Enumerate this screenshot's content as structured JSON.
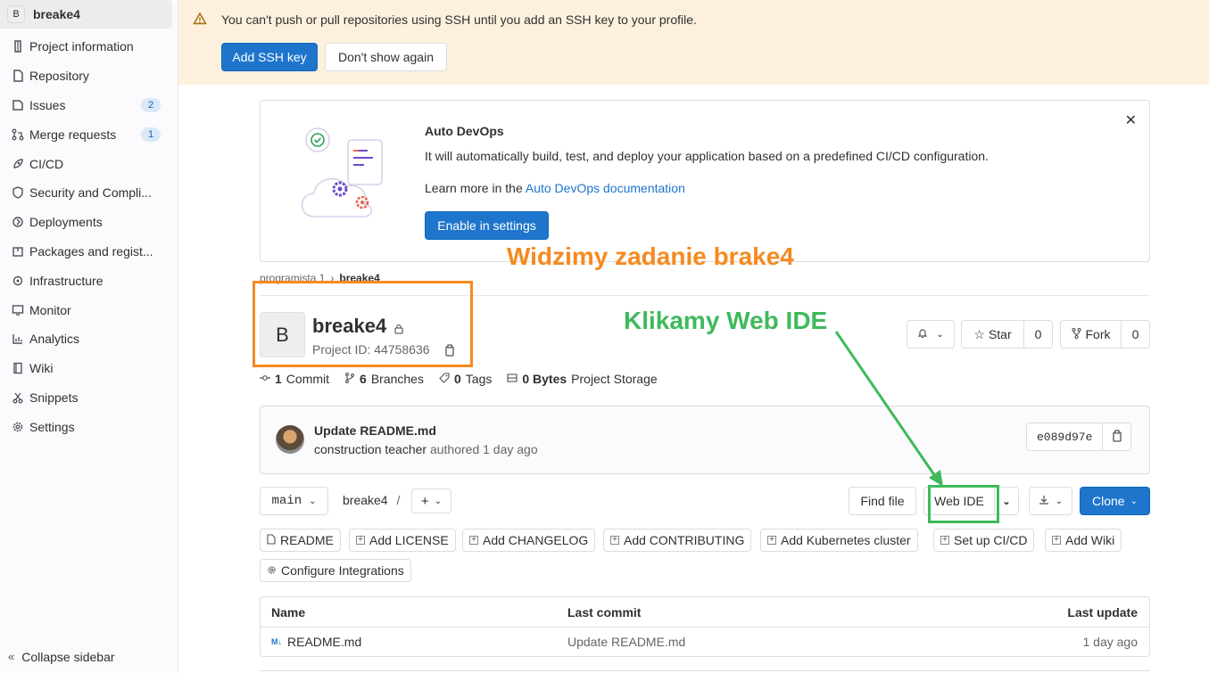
{
  "sidebar": {
    "project_avatar": "B",
    "project_name": "breake4",
    "items": [
      {
        "label": "Project information",
        "icon": "info-icon"
      },
      {
        "label": "Repository",
        "icon": "doc-icon"
      },
      {
        "label": "Issues",
        "icon": "issues-icon",
        "badge": "2"
      },
      {
        "label": "Merge requests",
        "icon": "merge-request-icon",
        "badge": "1"
      },
      {
        "label": "CI/CD",
        "icon": "rocket-icon"
      },
      {
        "label": "Security and Compli...",
        "icon": "shield-icon"
      },
      {
        "label": "Deployments",
        "icon": "deployments-icon"
      },
      {
        "label": "Packages and regist...",
        "icon": "package-icon"
      },
      {
        "label": "Infrastructure",
        "icon": "cloud-gear-icon"
      },
      {
        "label": "Monitor",
        "icon": "monitor-icon"
      },
      {
        "label": "Analytics",
        "icon": "chart-icon"
      },
      {
        "label": "Wiki",
        "icon": "book-icon"
      },
      {
        "label": "Snippets",
        "icon": "scissors-icon"
      },
      {
        "label": "Settings",
        "icon": "gear-icon"
      }
    ],
    "collapse_label": "Collapse sidebar"
  },
  "alert": {
    "text": "You can't push or pull repositories using SSH until you add an SSH key to your profile.",
    "primary_label": "Add SSH key",
    "secondary_label": "Don't show again"
  },
  "devops": {
    "title": "Auto DevOps",
    "description": "It will automatically build, test, and deploy your application based on a predefined CI/CD configuration.",
    "learn_prefix": "Learn more in the",
    "learn_link": "Auto DevOps documentation",
    "button_label": "Enable in settings"
  },
  "annotations": {
    "orange_text": "Widzimy zadanie brake4",
    "green_text": "Klikamy Web IDE"
  },
  "breadcrumb": {
    "parent": "programista 1",
    "current": "breake4"
  },
  "project": {
    "avatar": "B",
    "name": "breake4",
    "id_text": "Project ID: 44758636",
    "star_label": "Star",
    "star_count": "0",
    "fork_label": "Fork",
    "fork_count": "0"
  },
  "stats": [
    {
      "count": "1",
      "label": "Commit",
      "icon": "commit-icon"
    },
    {
      "count": "6",
      "label": "Branches",
      "icon": "branch-icon"
    },
    {
      "count": "0",
      "label": "Tags",
      "icon": "tag-icon"
    },
    {
      "count": "0 Bytes",
      "label": "Project Storage",
      "icon": "storage-icon"
    }
  ],
  "commit": {
    "title": "Update README.md",
    "author": "construction teacher",
    "meta": "authored 1 day ago",
    "sha": "e089d97e"
  },
  "toolbar": {
    "branch": "main",
    "path": "breake4",
    "separator": "/",
    "find_file": "Find file",
    "web_ide": "Web IDE",
    "clone": "Clone"
  },
  "quick_actions": [
    {
      "label": "README",
      "icon": "doc-icon"
    },
    {
      "label": "Add LICENSE",
      "icon": "plus-square-icon"
    },
    {
      "label": "Add CHANGELOG",
      "icon": "plus-square-icon"
    },
    {
      "label": "Add CONTRIBUTING",
      "icon": "plus-square-icon"
    },
    {
      "label": "Add Kubernetes cluster",
      "icon": "plus-square-icon"
    },
    {
      "label": "Set up CI/CD",
      "icon": "plus-square-icon"
    },
    {
      "label": "Add Wiki",
      "icon": "plus-square-icon"
    },
    {
      "label": "Configure Integrations",
      "icon": "gear-icon"
    }
  ],
  "table": {
    "headers": [
      "Name",
      "Last commit",
      "Last update"
    ],
    "rows": [
      {
        "name": "README.md",
        "last_commit": "Update README.md",
        "last_update": "1 day ago"
      }
    ]
  }
}
